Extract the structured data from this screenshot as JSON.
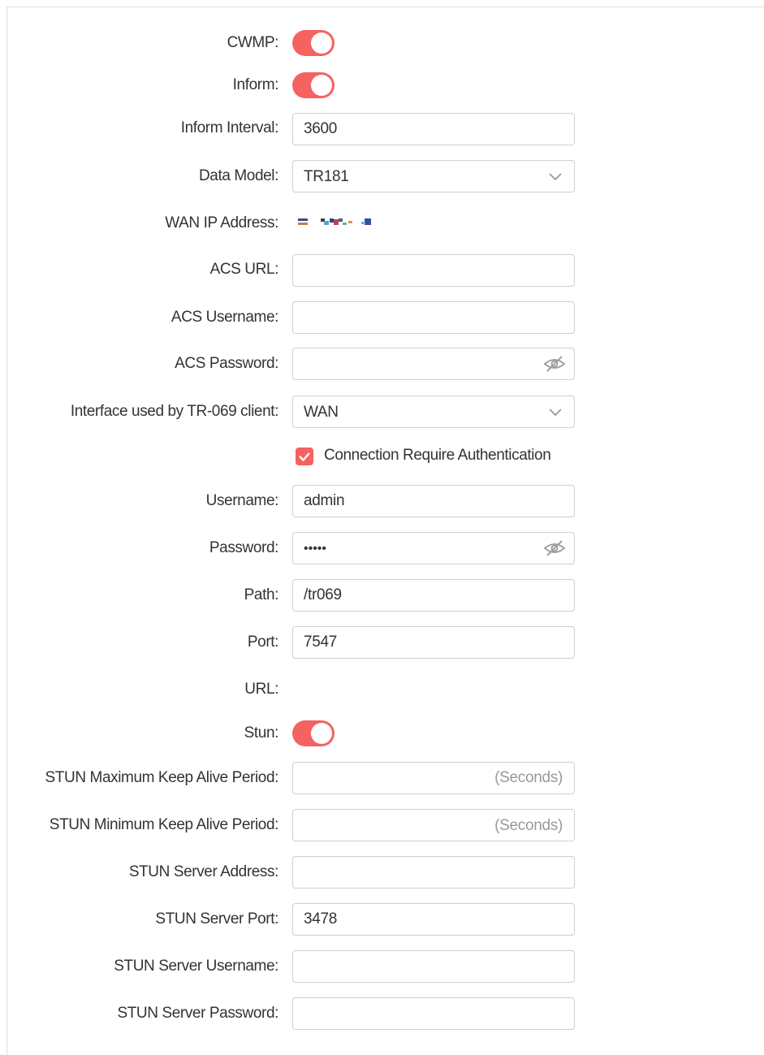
{
  "cwmp": {
    "label": "CWMP:",
    "enabled": true
  },
  "inform": {
    "label": "Inform:",
    "enabled": true
  },
  "inform_interval": {
    "label": "Inform Interval:",
    "value": "3600"
  },
  "data_model": {
    "label": "Data Model:",
    "value": "TR181"
  },
  "wan_ip": {
    "label": "WAN IP Address:"
  },
  "acs_url": {
    "label": "ACS URL:",
    "value": ""
  },
  "acs_username": {
    "label": "ACS Username:",
    "value": ""
  },
  "acs_password": {
    "label": "ACS Password:",
    "value": ""
  },
  "interface": {
    "label": "Interface used by TR-069 client:",
    "value": "WAN"
  },
  "conn_auth": {
    "label": "Connection Require Authentication",
    "checked": true
  },
  "username": {
    "label": "Username:",
    "value": "admin"
  },
  "password": {
    "label": "Password:",
    "value": "•••••"
  },
  "path": {
    "label": "Path:",
    "value": "/tr069"
  },
  "port": {
    "label": "Port:",
    "value": "7547"
  },
  "url": {
    "label": "URL:"
  },
  "stun": {
    "label": "Stun:",
    "enabled": true
  },
  "stun_max": {
    "label": "STUN Maximum Keep Alive Period:",
    "value": "",
    "suffix": "(Seconds)"
  },
  "stun_min": {
    "label": "STUN Minimum Keep Alive Period:",
    "value": "",
    "suffix": "(Seconds)"
  },
  "stun_server_address": {
    "label": "STUN Server Address:",
    "value": ""
  },
  "stun_server_port": {
    "label": "STUN Server Port:",
    "value": "3478"
  },
  "stun_server_username": {
    "label": "STUN Server Username:",
    "value": ""
  },
  "stun_server_password": {
    "label": "STUN Server Password:",
    "value": ""
  },
  "colors": {
    "accent": "#f46262",
    "border": "#cfcfcf",
    "text": "#333333",
    "placeholder": "#9a9a9a"
  },
  "icons": {
    "password_toggle": "eye-slash-icon",
    "select_arrow": "chevron-down-icon",
    "checkbox": "checkmark-icon"
  }
}
